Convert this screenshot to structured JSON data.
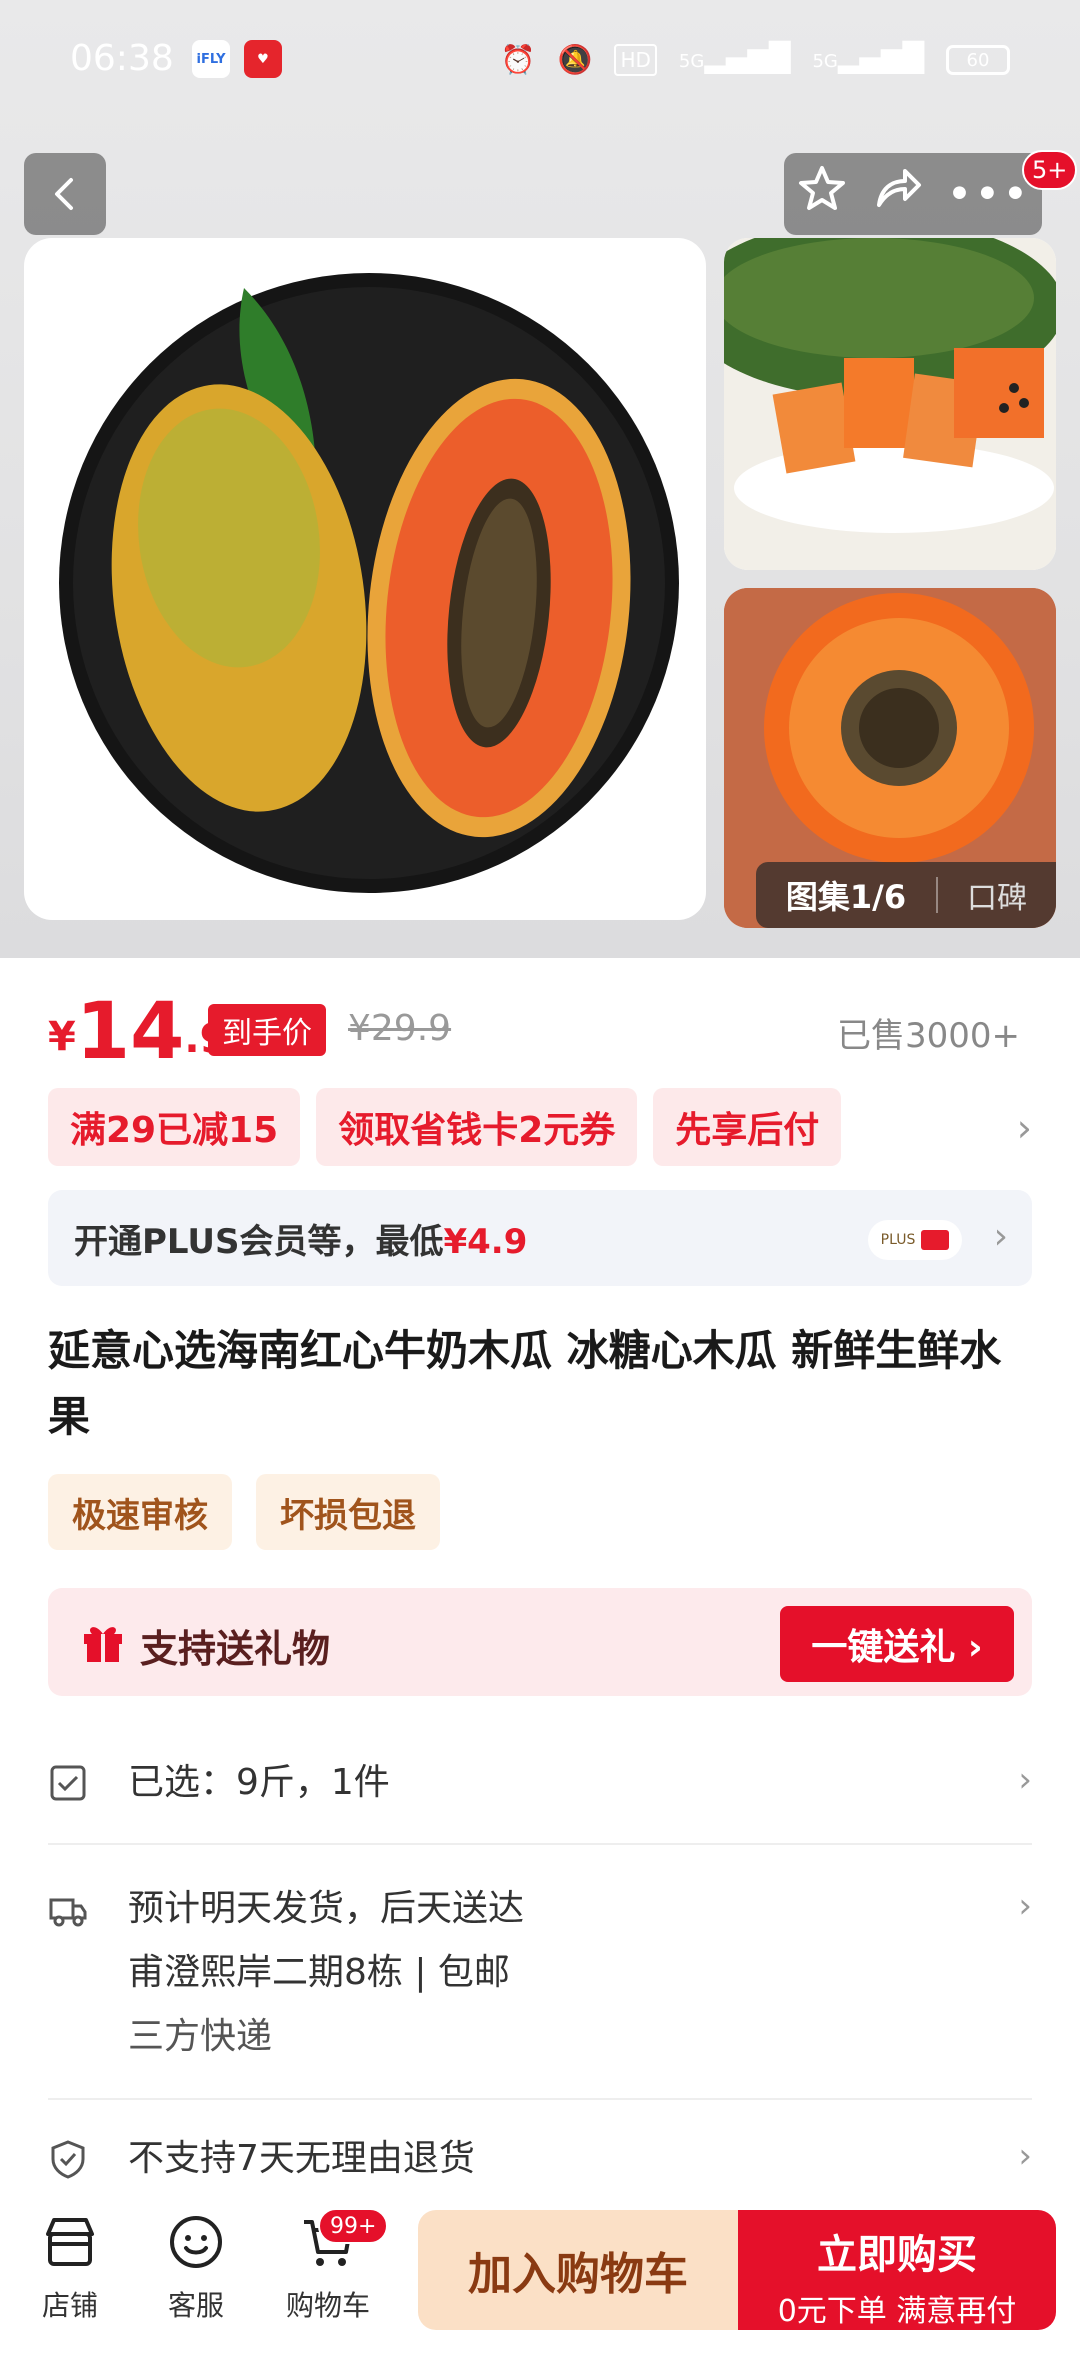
{
  "status_bar": {
    "time": "06:38",
    "app_badge_1": "iFLY",
    "network_1": "5G",
    "network_2": "5G",
    "battery": "60"
  },
  "header": {
    "notification_badge": "5+"
  },
  "gallery": {
    "counter": "图集1/6",
    "alt_tab": "口碑"
  },
  "price": {
    "currency": "¥",
    "integer": "14",
    "decimal": ".9",
    "badge": "到手价",
    "original": "¥29.9",
    "sold": "已售3000+"
  },
  "promotions": [
    "满29已减15",
    "领取省钱卡2元券",
    "先享后付"
  ],
  "plus": {
    "text_prefix": "开通PLUS会员等，最低",
    "text_price": "¥4.9",
    "logo": "PLUS"
  },
  "product": {
    "title": "延意心选海南红心牛奶木瓜 冰糖心木瓜 新鲜生鲜水果",
    "tags": [
      "极速审核",
      "坏损包退"
    ]
  },
  "gift": {
    "label": "支持送礼物",
    "button": "一键送礼 ›"
  },
  "specs": {
    "selected": "已选：9斤，1件",
    "delivery_line1": "预计明天发货，后天送达",
    "delivery_line2": "甫澄熙岸二期8栋 | 包邮",
    "delivery_line3": "三方快递",
    "returns": "不支持7天无理由退货"
  },
  "bottom_bar": {
    "store": "店铺",
    "service": "客服",
    "cart": "购物车",
    "cart_badge": "99+",
    "add_to_cart": "加入购物车",
    "buy_now": "立即购买",
    "buy_now_sub": "0元下单 满意再付"
  },
  "colors": {
    "accent_red": "#e61b2c",
    "add_cart_bg": "#fbe0c6",
    "tag_bg": "#fdf1e4"
  }
}
